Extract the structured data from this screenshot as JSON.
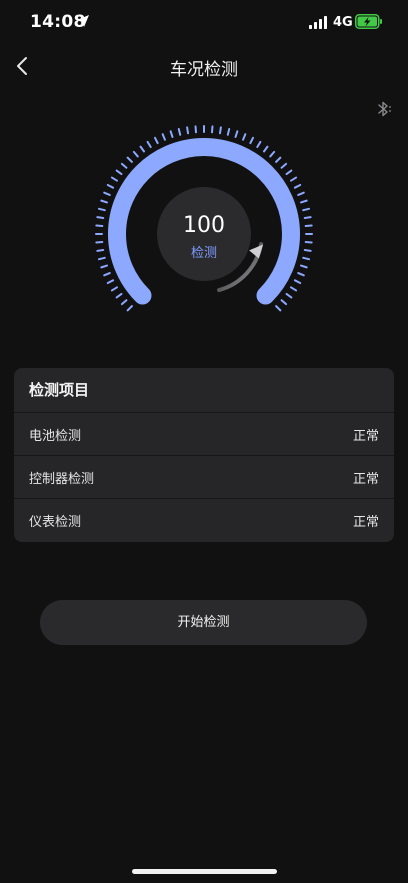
{
  "status_bar": {
    "time": "14:08",
    "network": "4G"
  },
  "nav": {
    "title": "车况检测"
  },
  "gauge": {
    "value": "100",
    "label": "检测",
    "progress_percent": 100
  },
  "check_card": {
    "header": "检测项目",
    "items": [
      {
        "name": "电池检测",
        "status": "正常"
      },
      {
        "name": "控制器检测",
        "status": "正常"
      },
      {
        "name": "仪表检测",
        "status": "正常"
      }
    ]
  },
  "actions": {
    "start_label": "开始检测"
  },
  "colors": {
    "accent": "#8ca8ff",
    "background": "#111112",
    "card": "#262628",
    "battery_charge": "#42c947"
  }
}
